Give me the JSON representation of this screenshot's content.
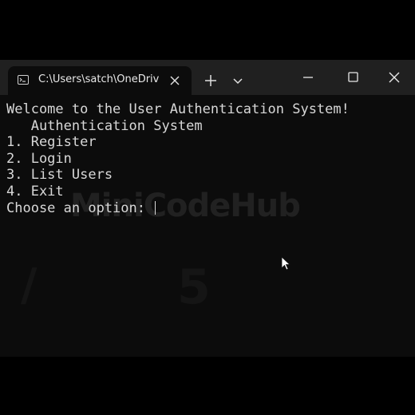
{
  "window": {
    "tab_title": "C:\\Users\\satch\\OneDriv",
    "icons": {
      "tab": "terminal-icon",
      "tab_close": "close-icon",
      "new_tab": "plus-icon",
      "dropdown": "chevron-down-icon",
      "minimize": "minimize-icon",
      "maximize": "maximize-icon",
      "close": "close-icon"
    }
  },
  "terminal": {
    "lines": [
      "Welcome to the User Authentication System!",
      "   Authentication System",
      "1. Register",
      "2. Login",
      "3. List Users",
      "4. Exit"
    ],
    "prompt": "Choose an option: "
  },
  "watermark": {
    "text": "MiniCodeHub"
  },
  "colors": {
    "background": "#000000",
    "titlebar": "#202020",
    "terminal_bg": "#0c0c0c",
    "text": "#d8d8d8"
  }
}
